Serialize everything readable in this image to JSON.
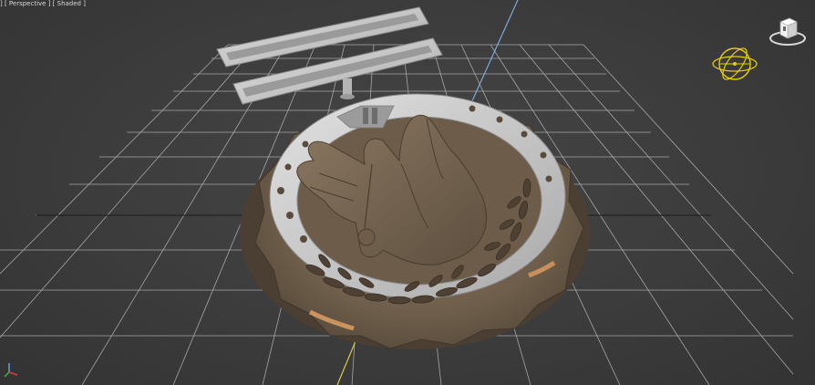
{
  "viewport": {
    "label_parts": [
      "] [",
      "Perspective",
      "] [",
      "Shaded",
      "]"
    ],
    "view_mode": "Perspective",
    "shading_mode": "Shaded"
  },
  "colors": {
    "background": "#3a3a3a",
    "grid": "#b8b8b8",
    "bronze": "#6f5f4c",
    "silver": "#c9c9c9",
    "highlight_orange": "#d79a60",
    "axis_blue": "#6aa6e0",
    "axis_yellow": "#e8d54a",
    "orbit_gizmo": "#e8d000"
  },
  "icons": {
    "viewcube": "viewcube-icon",
    "orbit": "orbit-gizmo-icon",
    "axis": "axis-tripod-icon"
  }
}
